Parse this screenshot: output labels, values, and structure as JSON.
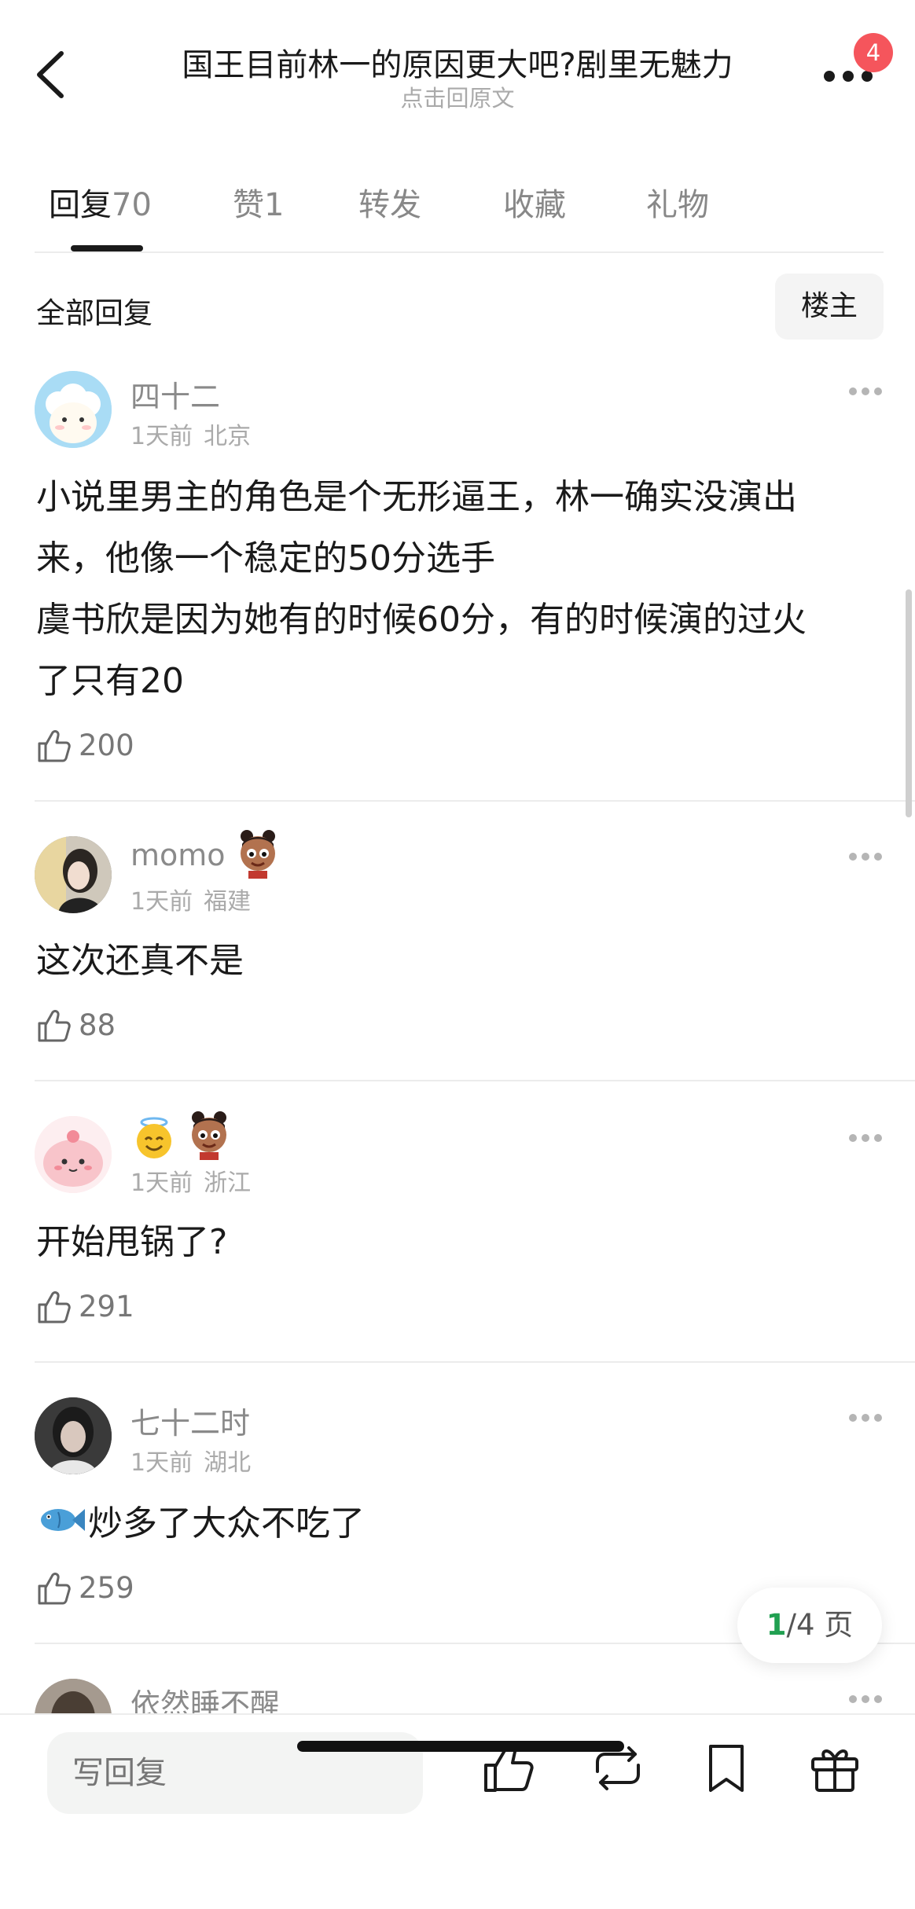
{
  "header": {
    "title": "国王目前林一的原因更大吧?剧里无魅力",
    "subtitle": "点击回原文",
    "badge_count": "4"
  },
  "tabs": [
    {
      "label": "回复",
      "count": "70",
      "active": true
    },
    {
      "label": "赞",
      "count": "1",
      "active": false
    },
    {
      "label": "转发",
      "count": "",
      "active": false
    },
    {
      "label": "收藏",
      "count": "",
      "active": false
    },
    {
      "label": "礼物",
      "count": "",
      "active": false
    }
  ],
  "filter": {
    "title": "全部回复",
    "owner_only_label": "楼主"
  },
  "comments": [
    {
      "username": "四十二",
      "time": "1天前",
      "location": "北京",
      "text_lines": [
        "小说里男主的角色是个无形逼王，林一确实没演出",
        "来，他像一个稳定的50分选手",
        "虞书欣是因为她有的时候60分，有的时候演的过火",
        "了只有20"
      ],
      "likes": "200",
      "avatar_icon": "sheep-avatar"
    },
    {
      "username": "momo",
      "time": "1天前",
      "location": "福建",
      "text_lines": [
        "这次还真不是"
      ],
      "likes": "88",
      "avatar_icon": "photo-avatar",
      "badges": [
        "nezha-emoji"
      ]
    },
    {
      "username": "",
      "time": "1天前",
      "location": "浙江",
      "text_lines": [
        "开始甩锅了?"
      ],
      "likes": "291",
      "avatar_icon": "pink-blob-avatar",
      "name_emojis": [
        "halo-smile-emoji",
        "nezha-emoji"
      ]
    },
    {
      "username": "七十二时",
      "time": "1天前",
      "location": "湖北",
      "text_lines": [
        "炒多了大众不吃了"
      ],
      "text_prefix_emoji": "fish-emoji",
      "likes": "259",
      "avatar_icon": "photo-avatar"
    },
    {
      "username": "依然睡不醒",
      "avatar_icon": "photo-avatar"
    }
  ],
  "pager": {
    "current": "1",
    "total_suffix": "/4 页"
  },
  "bottom_bar": {
    "reply_placeholder": "写回复",
    "icons": [
      "like-icon",
      "repost-icon",
      "bookmark-icon",
      "gift-icon"
    ]
  },
  "colors": {
    "accent_green": "#21a051",
    "badge_red": "#f5555c",
    "muted_text": "#8a8a8a"
  }
}
